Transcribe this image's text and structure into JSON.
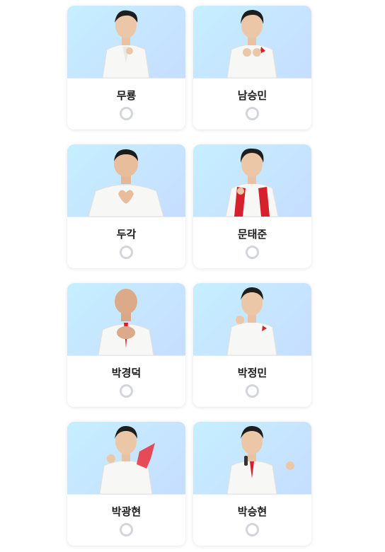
{
  "candidates": [
    {
      "name": "무룡",
      "selected": false,
      "icon": "person-photo"
    },
    {
      "name": "남승민",
      "selected": false,
      "icon": "person-photo"
    },
    {
      "name": "두각",
      "selected": false,
      "icon": "person-photo"
    },
    {
      "name": "문태준",
      "selected": false,
      "icon": "person-photo"
    },
    {
      "name": "박경덕",
      "selected": false,
      "icon": "person-photo"
    },
    {
      "name": "박정민",
      "selected": false,
      "icon": "person-photo"
    },
    {
      "name": "박광현",
      "selected": false,
      "icon": "person-photo"
    },
    {
      "name": "박승현",
      "selected": false,
      "icon": "person-photo"
    }
  ],
  "colors": {
    "photo_bg_start": "#c5efff",
    "photo_bg_end": "#c6ddff",
    "radio_border": "#d2d5da",
    "accent_red": "#d6202c"
  }
}
